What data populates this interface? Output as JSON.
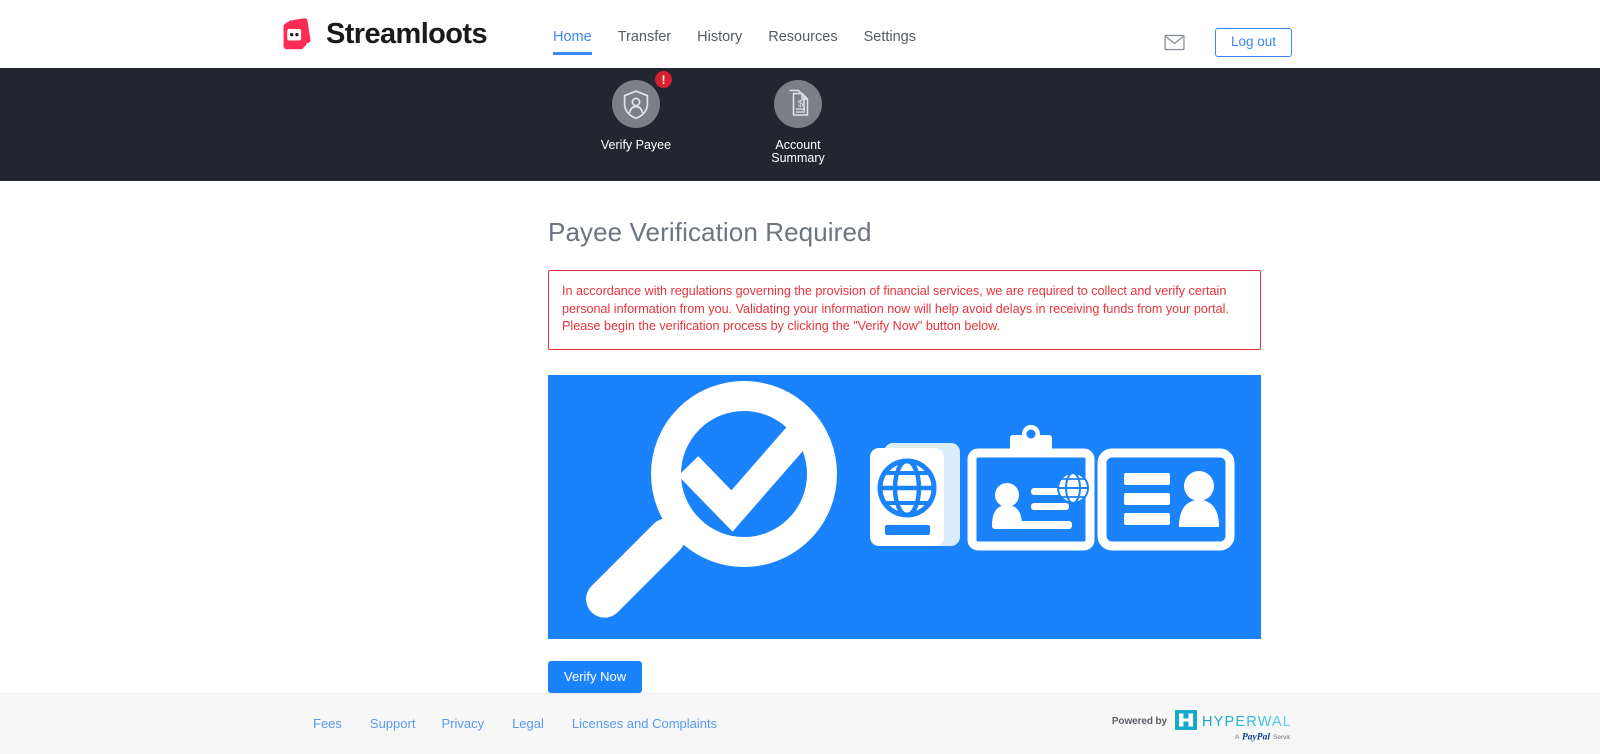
{
  "header": {
    "brand": "Streamloots",
    "brand_icon": "streamloots-card-logo",
    "nav": [
      {
        "label": "Home",
        "active": true
      },
      {
        "label": "Transfer",
        "active": false
      },
      {
        "label": "History",
        "active": false
      },
      {
        "label": "Resources",
        "active": false
      },
      {
        "label": "Settings",
        "active": false
      }
    ],
    "mail_icon": "envelope-icon",
    "logout_label": "Log out",
    "accent_color": "#3d87f5"
  },
  "subnav": {
    "background": "#23262e",
    "items": [
      {
        "label": "Verify Payee",
        "icon": "shield-person-icon",
        "badge": "!",
        "badge_color": "#d8202f",
        "active": true
      },
      {
        "label": "Account\nSummary",
        "label_line1": "Account",
        "label_line2": "Summary",
        "icon": "document-dollar-icon",
        "active": false
      }
    ]
  },
  "main": {
    "title": "Payee Verification Required",
    "alert": {
      "text": "In accordance with regulations governing the provision of financial services, we are required to collect and verify certain personal information from you. Validating your information now will help avoid delays in receiving funds from your portal. Please begin the verification process by clicking the \"Verify Now\" button below.",
      "border_color": "#e8323c",
      "text_color": "#e8323c"
    },
    "banner": {
      "background": "#1a82fb",
      "icons": [
        "magnifier-check-icon",
        "passport-globe-icon",
        "id-badge-photo-icon",
        "id-card-person-icon"
      ]
    },
    "verify_button": {
      "label": "Verify Now",
      "color": "#1a82fb"
    }
  },
  "footer": {
    "links": [
      {
        "label": "Fees"
      },
      {
        "label": "Support"
      },
      {
        "label": "Privacy"
      },
      {
        "label": "Legal"
      },
      {
        "label": "Licenses and Complaints"
      }
    ],
    "powered_by": "Powered by",
    "brand": "HYPERWALLET",
    "sub_brand_prefix": "A",
    "sub_brand": "PayPal",
    "sub_brand_suffix": "Service",
    "link_color": "#5899f0"
  }
}
